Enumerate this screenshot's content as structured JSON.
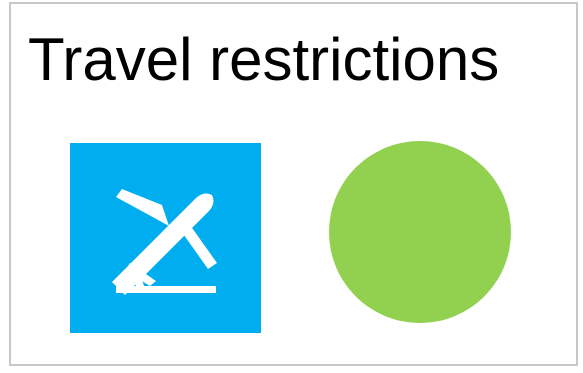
{
  "card": {
    "title": "Travel restrictions"
  },
  "icon": {
    "name": "airplane-departure-icon",
    "background_color": "#00adef",
    "glyph_color": "#ffffff"
  },
  "status": {
    "indicator_color": "#92d050"
  }
}
